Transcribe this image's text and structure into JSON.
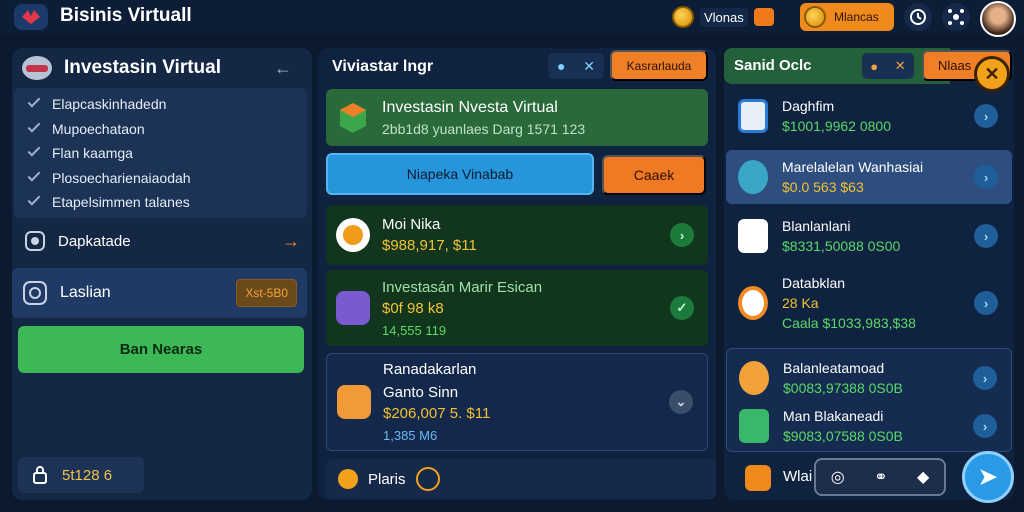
{
  "header": {
    "app_title": "Bisinis Virtuall",
    "coin_label": "Vlonas",
    "gem_label": "Mlancas"
  },
  "left": {
    "title": "Investasin Virtual",
    "checklist": [
      "Elapcaskinhadedn",
      "Mupoechataon",
      "Flan kaamga",
      "Plosoecharienaiaodah",
      "Etapelsimmen talanes"
    ],
    "link_label": "Dapkatade",
    "card_label": "Laslian",
    "card_tag": "Xst-5B0",
    "green_button": "Ban Nearas",
    "footer_value": "5t128 6"
  },
  "middle": {
    "title": "Viviastar lngr",
    "orange_button": "Kasrarlauda",
    "banner_title": "Investasin Nvesta Virtual",
    "banner_sub": "2bb1d8 yuanlaes Darg 1571 123",
    "blue_button": "Niapeka Vinabab",
    "cancel_button": "Caaek",
    "rows": [
      {
        "name": "Moi Nika",
        "value": "$988,917, $11",
        "sub": ""
      },
      {
        "name": "Investasán Marir Esican",
        "value": "$0f 98 k8",
        "sub": "14,555 119"
      },
      {
        "name": "Ranadakarlan",
        "name2": "Ganto Sinn",
        "value": "$206,007 5. $11",
        "sub": "1,385 M6"
      }
    ],
    "footer_label": "Plaris"
  },
  "right": {
    "title": "Sanid Oclc",
    "orange_button": "Nlaas",
    "rows": [
      {
        "name": "Daghfim",
        "value": "$1001,9962 0800"
      },
      {
        "name": "Marelalelan Wanhasiai",
        "value": "$0.0 563 $63"
      },
      {
        "name": "Blanlanlani",
        "value": "$8331,50088 0S00"
      },
      {
        "name": "Databklan",
        "value": "28 Ka",
        "value2": "Caala  $1033,983,$38"
      },
      {
        "name": "Balanleatamoad",
        "value": "$0083,97388 0S0B"
      },
      {
        "name": "Man Blakaneadi",
        "value": "$9083,07588 0S0B"
      }
    ],
    "footer_label": "Wlai"
  }
}
